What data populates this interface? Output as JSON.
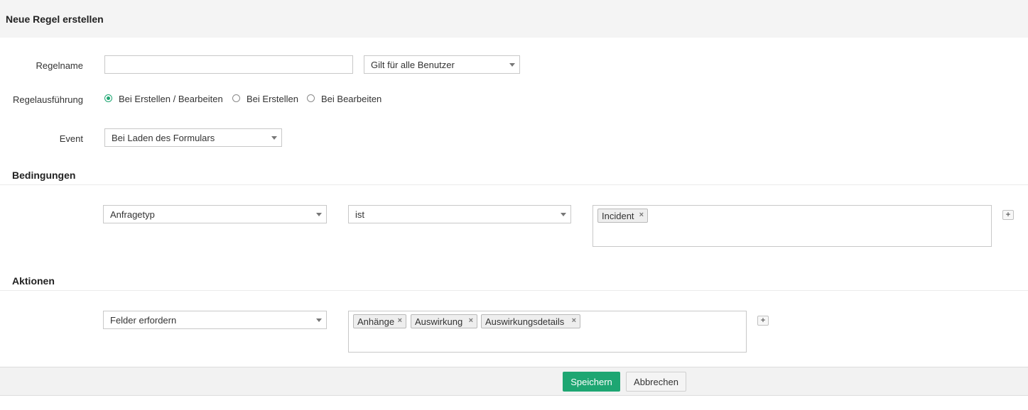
{
  "header": {
    "title": "Neue Regel erstellen"
  },
  "form": {
    "rule_name": {
      "label": "Regelname",
      "value": "",
      "placeholder": ""
    },
    "applies_to": {
      "value": "Gilt für alle Benutzer"
    },
    "execution": {
      "label": "Regelausführung",
      "options": [
        {
          "label": "Bei Erstellen / Bearbeiten",
          "checked": true
        },
        {
          "label": "Bei Erstellen",
          "checked": false
        },
        {
          "label": "Bei Bearbeiten",
          "checked": false
        }
      ]
    },
    "event": {
      "label": "Event",
      "value": "Bei Laden des Formulars"
    }
  },
  "conditions": {
    "title": "Bedingungen",
    "field": "Anfragetyp",
    "operator": "ist",
    "values": [
      "Incident"
    ],
    "add_icon": "plus-icon"
  },
  "actions": {
    "title": "Aktionen",
    "action": "Felder erfordern",
    "fields": [
      "Anhänge",
      "Auswirkung",
      "Auswirkungsdetails"
    ],
    "add_icon": "plus-icon"
  },
  "footer": {
    "save_label": "Speichern",
    "cancel_label": "Abbrechen"
  },
  "colors": {
    "accent": "#1ea672",
    "header_bg": "#f4f4f4"
  },
  "glyphs": {
    "remove": "×",
    "add": "+"
  }
}
